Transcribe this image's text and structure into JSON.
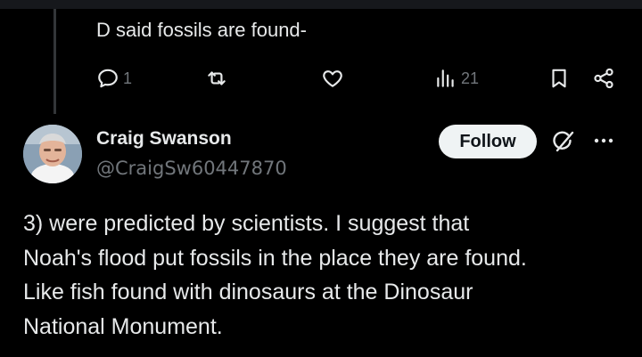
{
  "previous_tweet": {
    "text": "D said fossils are found-",
    "actions": {
      "reply_count": "1",
      "views_count": "21"
    }
  },
  "tweet": {
    "author": {
      "name": "Craig Swanson",
      "handle": "@CraigSw60447870"
    },
    "follow_label": "Follow",
    "body_lines": [
      "3) were predicted by scientists.  I suggest that",
      "Noah's flood put fossils in the place they are found.",
      "Like fish found with dinosaurs at the Dinosaur",
      "National Monument."
    ]
  },
  "icons": {
    "reply": "reply-icon",
    "retweet": "retweet-icon",
    "like": "like-icon",
    "views": "views-icon",
    "bookmark": "bookmark-icon",
    "share": "share-icon",
    "grok": "grok-icon",
    "more": "more-icon"
  },
  "colors": {
    "background": "#000000",
    "text_primary": "#e7e9ea",
    "text_secondary": "#71767b",
    "follow_button_bg": "#eff3f4",
    "thread_line": "#333639"
  }
}
